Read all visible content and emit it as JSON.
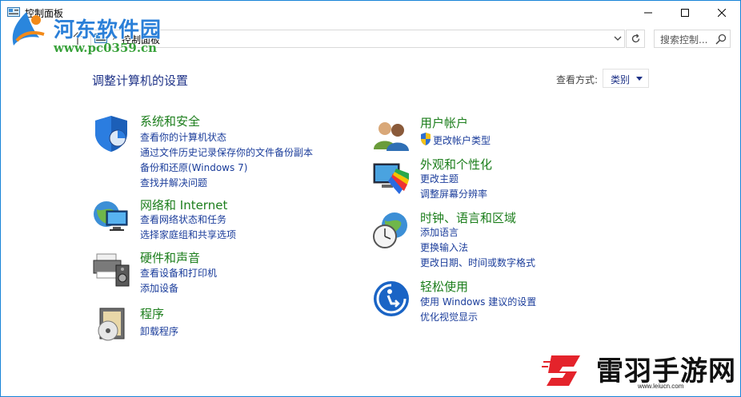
{
  "window": {
    "title": "控制面板"
  },
  "watermark_top": {
    "title": "河东软件园",
    "url": "www.pc0359.cn"
  },
  "watermark_bottom": {
    "title": "雷羽手游网",
    "url": "www.leiucn.com"
  },
  "address": {
    "separator": "›",
    "path": "控制面板",
    "search_placeholder": "搜索控制..."
  },
  "main": {
    "heading": "调整计算机的设置",
    "view_by_label": "查看方式:",
    "view_by_value": "类别"
  },
  "categories_left": [
    {
      "title": "系统和安全",
      "icon": "security-shield-icon",
      "links": [
        "查看你的计算机状态",
        "通过文件历史记录保存你的文件备份副本",
        "备份和还原(Windows 7)",
        "查找并解决问题"
      ]
    },
    {
      "title": "网络和 Internet",
      "icon": "network-globe-icon",
      "links": [
        "查看网络状态和任务",
        "选择家庭组和共享选项"
      ]
    },
    {
      "title": "硬件和声音",
      "icon": "printer-speaker-icon",
      "links": [
        "查看设备和打印机",
        "添加设备"
      ]
    },
    {
      "title": "程序",
      "icon": "programs-disc-icon",
      "links": [
        "卸载程序"
      ]
    }
  ],
  "categories_right": [
    {
      "title": "用户帐户",
      "icon": "users-icon",
      "links": [
        "更改帐户类型"
      ]
    },
    {
      "title": "外观和个性化",
      "icon": "monitor-palette-icon",
      "links": [
        "更改主题",
        "调整屏幕分辨率"
      ]
    },
    {
      "title": "时钟、语言和区域",
      "icon": "clock-globe-icon",
      "links": [
        "添加语言",
        "更换输入法",
        "更改日期、时间或数字格式"
      ]
    },
    {
      "title": "轻松使用",
      "icon": "ease-of-access-icon",
      "links": [
        "使用 Windows 建议的设置",
        "优化视觉显示"
      ]
    }
  ],
  "colors": {
    "category_title": "#1c7e1c",
    "link": "#1b3d9b",
    "heading": "#1e3287",
    "window_border": "#1883d7"
  }
}
